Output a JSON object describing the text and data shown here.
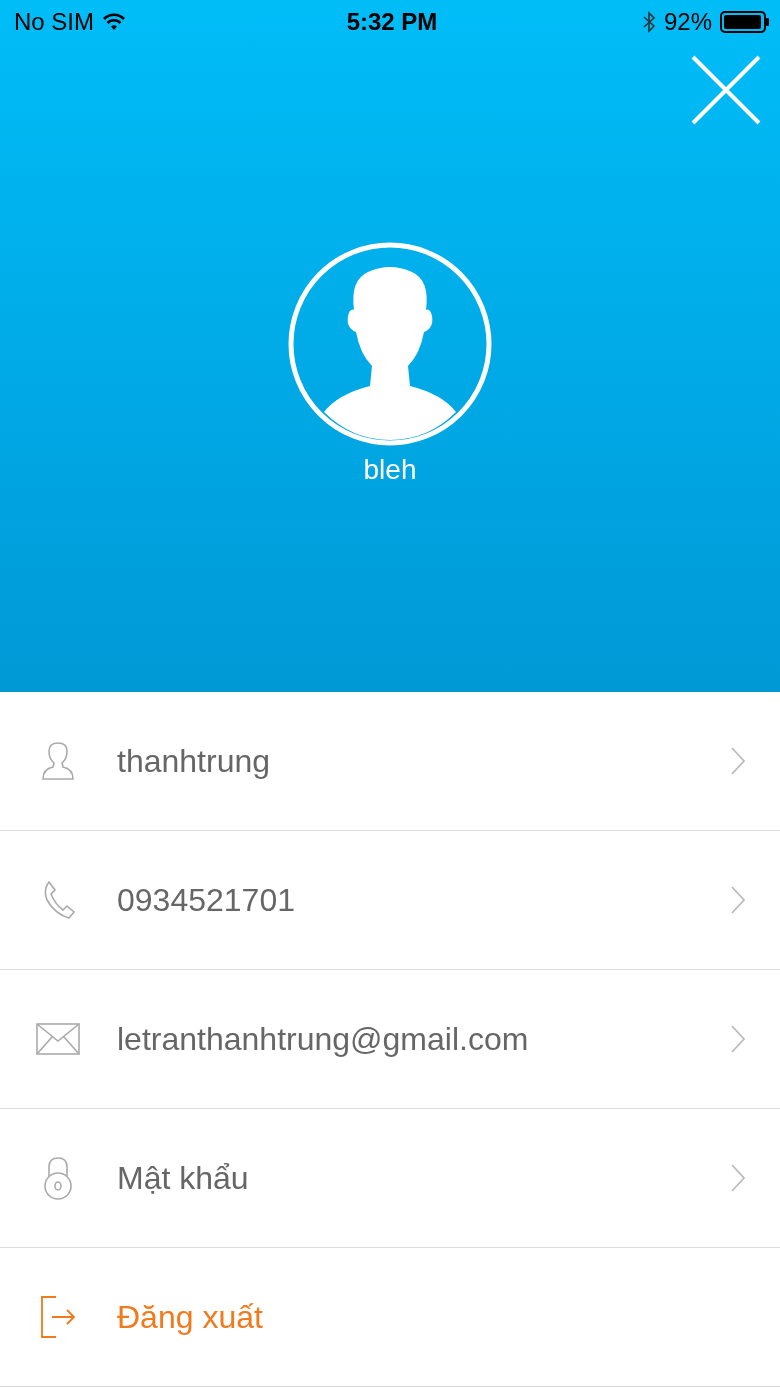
{
  "status_bar": {
    "carrier": "No SIM",
    "time": "5:32 PM",
    "battery": "92%"
  },
  "profile": {
    "name": "bleh"
  },
  "rows": [
    {
      "kind": "user",
      "text": "thanhtrung"
    },
    {
      "kind": "phone",
      "text": "0934521701"
    },
    {
      "kind": "email",
      "text": "letranthanhtrung@gmail.com"
    },
    {
      "kind": "password",
      "text": "Mật khẩu"
    },
    {
      "kind": "logout",
      "text": "Đăng xuất"
    }
  ]
}
